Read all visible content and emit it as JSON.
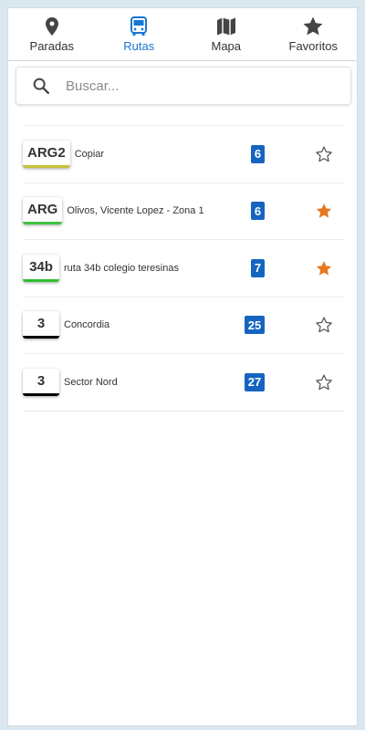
{
  "tabs": [
    {
      "label": "Paradas",
      "icon": "map-pin-icon"
    },
    {
      "label": "Rutas",
      "icon": "bus-icon"
    },
    {
      "label": "Mapa",
      "icon": "map-icon"
    },
    {
      "label": "Favoritos",
      "icon": "star-icon"
    }
  ],
  "active_tab": "Rutas",
  "colors": {
    "accent": "#1976d2",
    "count_badge": "#1565c0",
    "star_active": "#e87722",
    "star_inactive": "#555555"
  },
  "search": {
    "placeholder": "Buscar...",
    "value": ""
  },
  "routes": [
    {
      "code": "ARG2",
      "name": "Copiar",
      "count": "6",
      "color": "#c7c23a",
      "favorite": false
    },
    {
      "code": "ARG",
      "name": "Olivos, Vicente Lopez - Zona 1",
      "count": "6",
      "color": "#3ec13e",
      "favorite": true
    },
    {
      "code": "34b",
      "name": "ruta 34b colegio teresinas",
      "count": "7",
      "color": "#2ec02e",
      "favorite": true
    },
    {
      "code": "3",
      "name": "Concordia",
      "count": "25",
      "color": "#000000",
      "favorite": false
    },
    {
      "code": "3",
      "name": "Sector Nord",
      "count": "27",
      "color": "#000000",
      "favorite": false
    }
  ]
}
